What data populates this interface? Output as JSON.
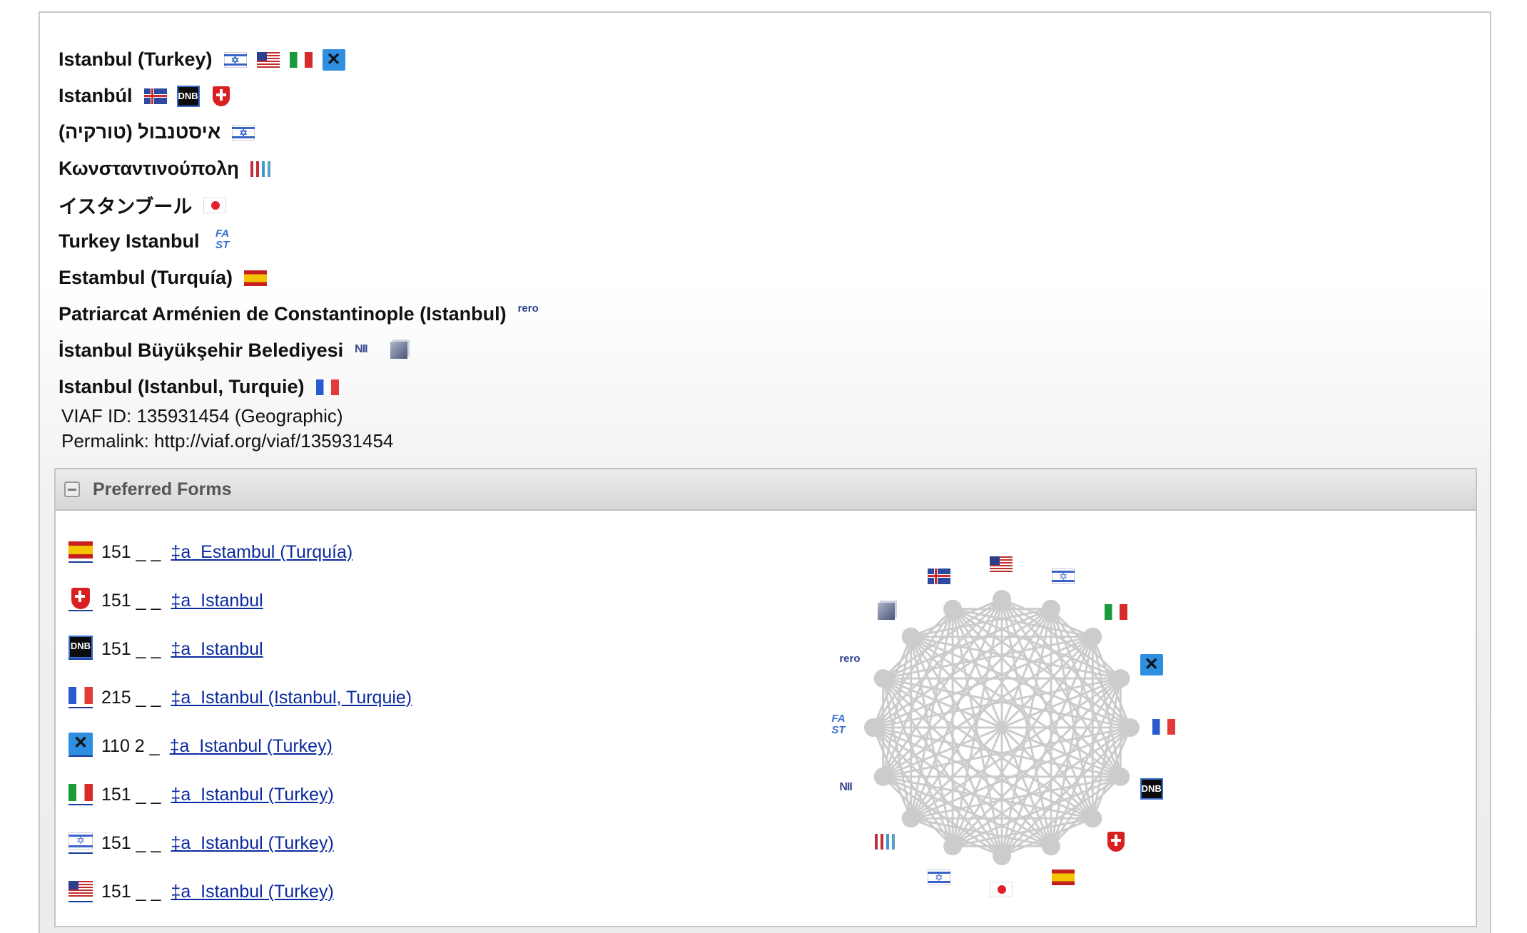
{
  "names": [
    {
      "text": "Istanbul (Turkey)",
      "sources": [
        "israel-flag",
        "usa-flag",
        "italy-flag",
        "bne-logo"
      ]
    },
    {
      "text": "Istanbúl",
      "sources": [
        "iceland-flag",
        "dnb-logo",
        "swiss-flag"
      ]
    },
    {
      "text": "איסטנבול (טורקיה)",
      "sources": [
        "israel-flag"
      ]
    },
    {
      "text": "Κωνσταντινούπολη",
      "sources": [
        "wikidata-logo"
      ]
    },
    {
      "text": "イスタンブール",
      "sources": [
        "japan-flag"
      ]
    },
    {
      "text": "Turkey Istanbul",
      "sources": [
        "fast-logo"
      ]
    },
    {
      "text": "Estambul (Turquía)",
      "sources": [
        "spain-flag"
      ]
    },
    {
      "text": "Patriarcat Arménien de Constantinople (Istanbul)",
      "sources": [
        "rero-logo"
      ]
    },
    {
      "text": "İstanbul Büyükşehir Belediyesi",
      "sources": [
        "nii-logo",
        "ndl-cube-logo"
      ]
    },
    {
      "text": "Istanbul (Istanbul, Turquie)",
      "sources": [
        "france-flag"
      ]
    }
  ],
  "viaf_id_line": "VIAF ID: 135931454 (Geographic)",
  "permalink_line": "Permalink: http://viaf.org/viaf/135931454",
  "panel": {
    "title": "Preferred Forms"
  },
  "preferred_forms": [
    {
      "source": "spain-flag",
      "code": "151 _ _",
      "subfield": "‡a",
      "link": "Estambul (Turquía)"
    },
    {
      "source": "swiss-flag",
      "code": "151 _ _",
      "subfield": "‡a",
      "link": "Istanbul"
    },
    {
      "source": "dnb-logo",
      "code": "151 _ _",
      "subfield": "‡a",
      "link": "Istanbul"
    },
    {
      "source": "france-flag",
      "code": "215 _ _",
      "subfield": "‡a",
      "link": "Istanbul (Istanbul, Turquie)"
    },
    {
      "source": "bne-logo",
      "code": "110 2 _",
      "subfield": "‡a",
      "link": "Istanbul (Turkey)"
    },
    {
      "source": "italy-flag",
      "code": "151 _ _",
      "subfield": "‡a",
      "link": "Istanbul (Turkey)"
    },
    {
      "source": "israel-flag",
      "code": "151 _ _",
      "subfield": "‡a",
      "link": "Istanbul (Turkey)"
    },
    {
      "source": "usa-flag",
      "code": "151 _ _",
      "subfield": "‡a",
      "link": "Istanbul (Turkey)"
    }
  ],
  "graph_nodes": [
    "usa-flag",
    "israel-flag",
    "italy-flag",
    "bne-logo",
    "france-flag",
    "dnb-logo",
    "swiss-flag",
    "spain-flag",
    "japan-flag",
    "israel-flag",
    "wikidata-logo",
    "nii-logo",
    "fast-logo",
    "rero-logo",
    "ndl-cube-logo",
    "iceland-flag"
  ],
  "logo_text": {
    "dnb": "DNB",
    "fast_top": "FA",
    "fast_bottom": "ST",
    "rero": "rero",
    "nii": "NII"
  },
  "colors": {
    "link": "#0b2a9e",
    "edge": "#cccccc",
    "header_text": "#555555"
  }
}
